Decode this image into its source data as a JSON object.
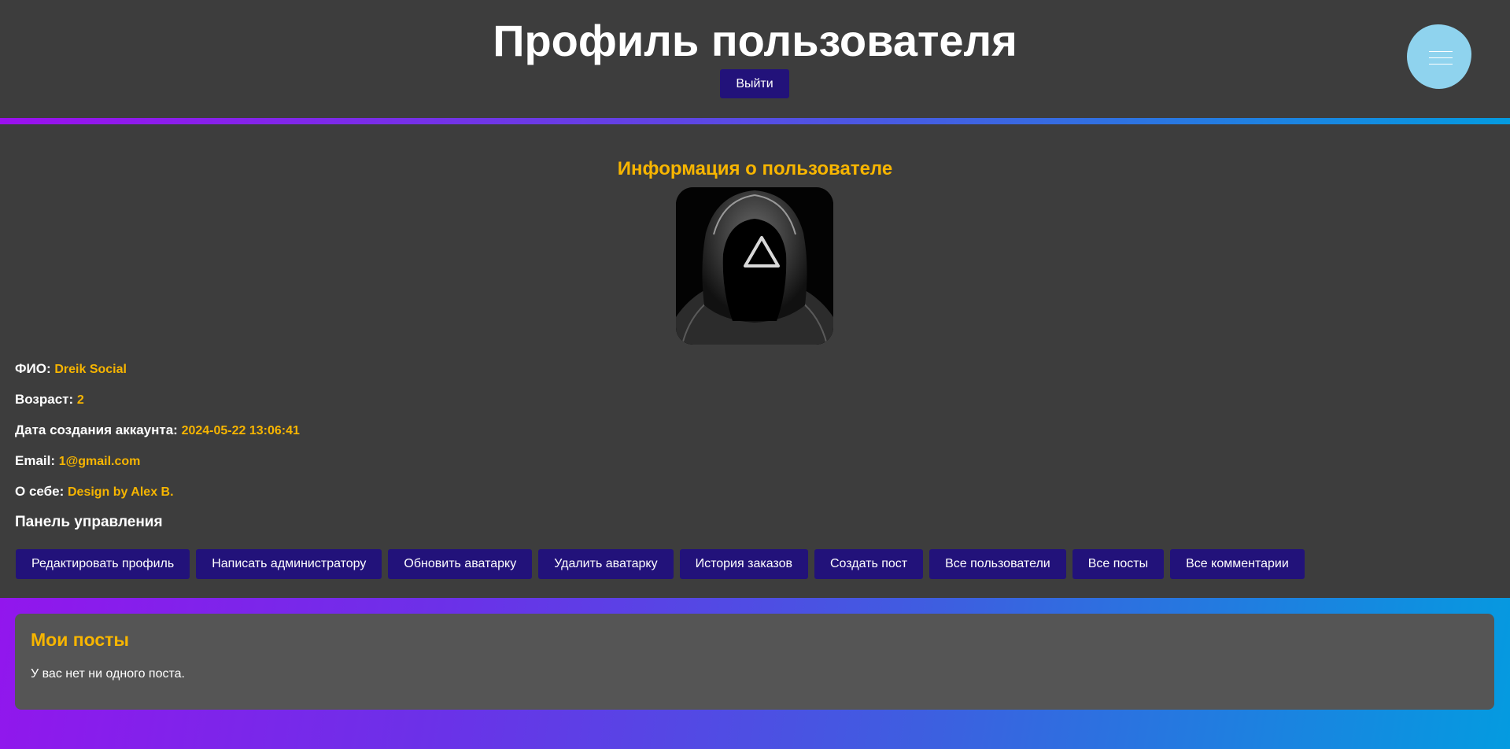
{
  "header": {
    "title": "Профиль пользователя",
    "logout_label": "Выйти",
    "menu_icon": "hamburger-icon"
  },
  "user_info": {
    "section_title": "Информация о пользователе",
    "avatar_description": "hooded-figure-triangle",
    "fields": [
      {
        "label": "ФИО:",
        "value": "Dreik Social"
      },
      {
        "label": "Возраст:",
        "value": "2"
      },
      {
        "label": "Дата создания аккаунта:",
        "value": "2024-05-22 13:06:41"
      },
      {
        "label": "Email:",
        "value": "1@gmail.com"
      },
      {
        "label": "О себе:",
        "value": "Design by Alex B."
      }
    ]
  },
  "control_panel": {
    "title": "Панель управления",
    "buttons": [
      "Редактировать профиль",
      "Написать администратору",
      "Обновить аватарку",
      "Удалить аватарку",
      "История заказов",
      "Создать пост",
      "Все пользователи",
      "Все посты",
      "Все комментарии"
    ]
  },
  "posts": {
    "title": "Мои посты",
    "empty_text": "У вас нет ни одного поста."
  },
  "colors": {
    "panel_bg": "#3d3d3d",
    "card_bg": "#555555",
    "accent_yellow": "#f7b500",
    "button_bg": "#22127a",
    "menu_button": "#8fd3ee",
    "gradient_start": "#9b10ee",
    "gradient_end": "#049be0"
  }
}
